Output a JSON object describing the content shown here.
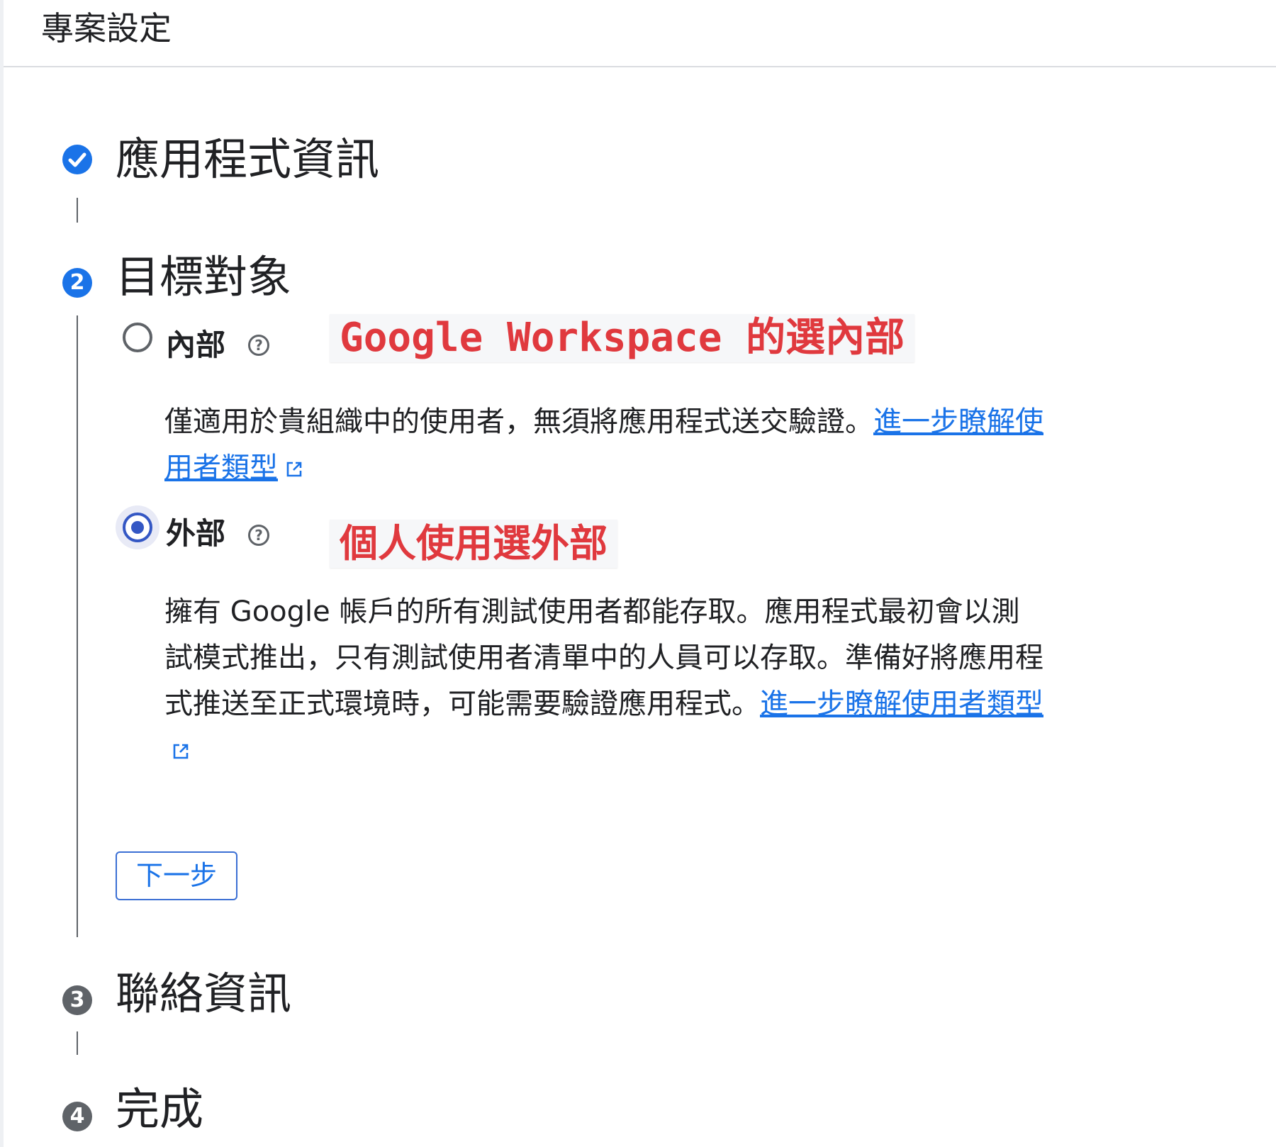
{
  "header": {
    "title": "專案設定"
  },
  "steps": [
    {
      "number": "✓",
      "title": "應用程式資訊",
      "status": "done"
    },
    {
      "number": "2",
      "title": "目標對象",
      "status": "active"
    },
    {
      "number": "3",
      "title": "聯絡資訊",
      "status": "todo"
    },
    {
      "number": "4",
      "title": "完成",
      "status": "todo"
    }
  ],
  "audience": {
    "internal": {
      "label": "內部",
      "selected": false,
      "help_icon": "help-circle-icon",
      "description": "僅適用於貴組織中的使用者，無須將應用程式送交驗證。",
      "link_text": "進一步瞭解使用者類型"
    },
    "external": {
      "label": "外部",
      "selected": true,
      "help_icon": "help-circle-icon",
      "description": "擁有 Google 帳戶的所有測試使用者都能存取。應用程式最初會以測試模式推出，只有測試使用者清單中的人員可以存取。準備好將應用程式推送至正式環境時，可能需要驗證應用程式。",
      "link_text": "進一步瞭解使用者類型"
    }
  },
  "next_button": "下一步",
  "annotations": {
    "internal_note": "Google Workspace 的選內部",
    "external_note": "個人使用選外部"
  },
  "colors": {
    "accent": "#1a73e8",
    "radio_checked": "#3457c4",
    "annotation": "#e0393e"
  }
}
